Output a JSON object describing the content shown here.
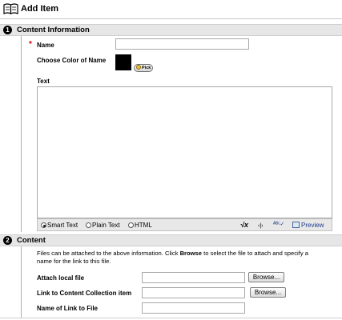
{
  "page": {
    "title": "Add Item"
  },
  "sections": {
    "content_information": {
      "number": "1",
      "label": "Content Information"
    },
    "content": {
      "number": "2",
      "label": "Content"
    }
  },
  "fields": {
    "name": {
      "label": "Name",
      "required_mark": "*",
      "value": ""
    },
    "color": {
      "label": "Choose Color of Name",
      "swatch_color": "#000000",
      "pick_label": "Pick"
    },
    "text": {
      "label": "Text",
      "value": ""
    }
  },
  "editor": {
    "modes": [
      {
        "label": "Smart Text",
        "selected": true
      },
      {
        "label": "Plain Text",
        "selected": false
      },
      {
        "label": "HTML",
        "selected": false
      }
    ],
    "tools": {
      "math_glyph": "√x",
      "link_glyph": "‹|›",
      "spell_glyph": "ᴬᴮᶜ✓"
    },
    "preview_label": "Preview"
  },
  "content": {
    "description_1": "Files can be attached to the above information. Click ",
    "description_bold": "Browse",
    "description_2": " to select the file to attach and specify a",
    "description_line2": "name for the link to this file.",
    "attach": {
      "label": "Attach local file",
      "value": "",
      "button": "Browse..."
    },
    "collection": {
      "label": "Link to Content Collection item",
      "value": "",
      "button": "Browse..."
    },
    "link_name": {
      "label": "Name of Link to File",
      "value": ""
    }
  },
  "colors": {
    "section_bg": "#e6e6e6",
    "required": "#cc0000",
    "link": "#1a3a8a"
  },
  "icons": {
    "header": "book-icon",
    "pick": "color-picker-icon",
    "preview": "preview-icon"
  }
}
